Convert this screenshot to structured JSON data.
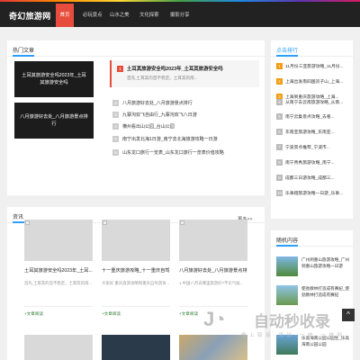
{
  "header": {
    "logo": "奇幻旅游网",
    "nav": [
      "首页",
      "必玩景点",
      "山水之美",
      "文化探索",
      "摄影分享"
    ]
  },
  "popular": {
    "title": "热门文章",
    "card1": "土耳其旅游安全吗2023年_土耳其旅游安全吗",
    "card2": "八月旅游好去处_八月旅游景点排行",
    "featured": {
      "num": "1",
      "title": "土耳其旅游安全吗2023年_土耳其旅游安全吗",
      "desc": "首先,土耳其的首不稳定。土耳其的南..."
    },
    "list": [
      {
        "num": "2",
        "text": "八月旅游好去处_八月旅游景点排行"
      },
      {
        "num": "3",
        "text": "九寨沟双飞自由行_九寨沟双飞八日游"
      },
      {
        "num": "4",
        "text": "横州看出山公园_台山公园"
      },
      {
        "num": "5",
        "text": "南宁出发北海1日游_南宁去北海旅游攻略一日游"
      },
      {
        "num": "6",
        "text": "山东龙口旅行一览表_山东龙口旅行一览表价值攻略"
      }
    ]
  },
  "news": {
    "title": "资讯",
    "more": "更多>>",
    "cards": [
      {
        "title": "土耳其旅游安全吗2023年_土耳...",
        "desc": "首先,土耳其的首不稳定。土耳其的南...",
        "link": "+文章阅读"
      },
      {
        "title": "十一重庆旅游攻略_十一重庆自驾...",
        "desc": "大家好,重庆旅游攻略和重庆自驾游攻...",
        "link": "+文章阅读"
      },
      {
        "title": "八月旅游好去处_八月旅游景点排...",
        "desc": "1.中国八月去哪里旅游好?不论气候...",
        "link": "+文章阅读"
      }
    ]
  },
  "hot_ranking": {
    "title": "点击排行",
    "items": [
      {
        "num": "1",
        "text": "11月份三亚旅游攻略_11月份..."
      },
      {
        "num": "2",
        "text": "上海出发南四国双子山_上海..."
      },
      {
        "num": "3",
        "text": "上海到重庆旅游攻略_上海..."
      },
      {
        "num": "4",
        "text": "从南宁去云南旅游攻略_从南..."
      },
      {
        "num": "5",
        "text": "南宁云集景点攻略_去看..."
      },
      {
        "num": "6",
        "text": "东南亚旅游攻略_东南亚..."
      },
      {
        "num": "7",
        "text": "宁波景点推荐_宁波市..."
      },
      {
        "num": "8",
        "text": "南宁青秀旅游攻略_南宁..."
      },
      {
        "num": "9",
        "text": "成都三日游攻略_成都三..."
      },
      {
        "num": "10",
        "text": "乐事翔旅游攻略一日游_乐事..."
      }
    ]
  },
  "random": {
    "title": "随机内容",
    "items": [
      {
        "text": "广州到重山旅游攻略_广州到重山旅游攻略一日游"
      },
      {
        "text": "使劲教林打造成有赛纪_使劲教林打造成有赛纪"
      },
      {
        "text": "乐高海南公园公园生_乐高海南公园公园"
      }
    ]
  },
  "watermark": {
    "brand": "自动秒收录",
    "sub": "做 上 链 接 · 来 访 · 一 统 · 一 统 网"
  },
  "scroll_top": "^"
}
